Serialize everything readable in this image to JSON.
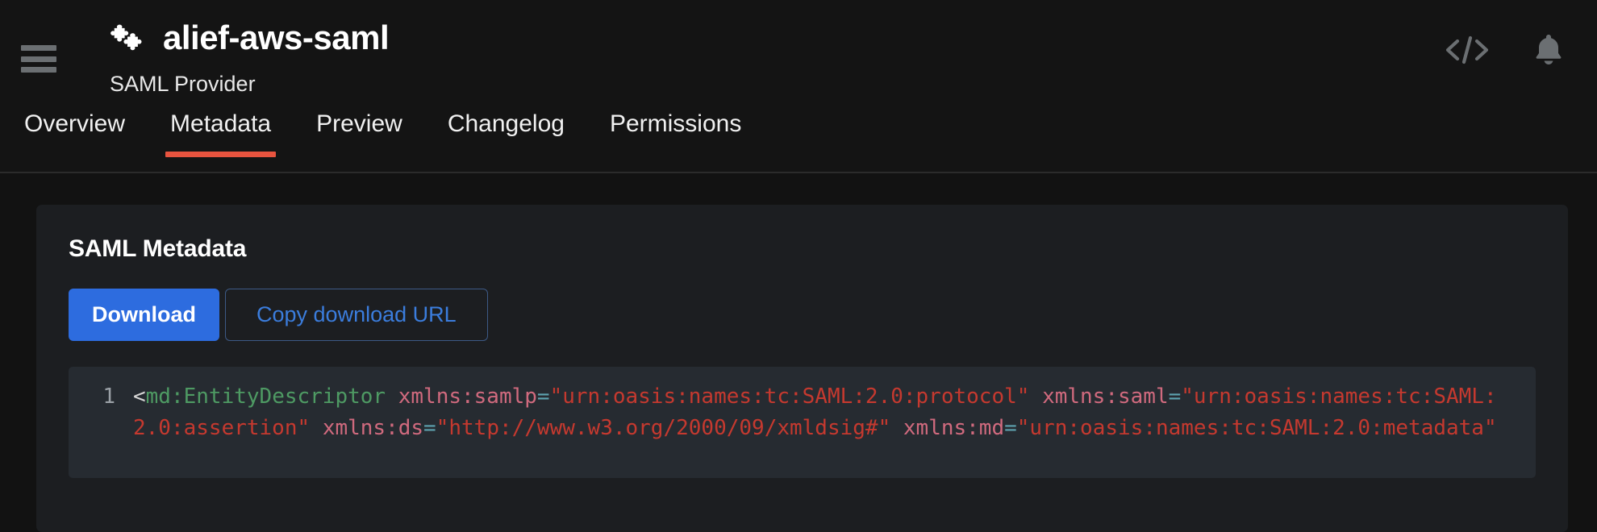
{
  "header": {
    "menu_icon": "hamburger-menu-icon",
    "app_icon": "puzzle-piece-icon",
    "title": "alief-aws-saml",
    "subtitle": "SAML Provider",
    "actions": [
      {
        "name": "code-icon",
        "label": "</>"
      },
      {
        "name": "bell-icon",
        "label": "Notifications"
      }
    ]
  },
  "tabs": [
    {
      "label": "Overview",
      "active": false
    },
    {
      "label": "Metadata",
      "active": true
    },
    {
      "label": "Preview",
      "active": false
    },
    {
      "label": "Changelog",
      "active": false
    },
    {
      "label": "Permissions",
      "active": false
    }
  ],
  "card": {
    "title": "SAML Metadata",
    "download_label": "Download",
    "copy_url_label": "Copy download URL"
  },
  "code": {
    "line_number": "1",
    "tokens": [
      {
        "t": "punct",
        "v": "<"
      },
      {
        "t": "tag",
        "v": "md:EntityDescriptor"
      },
      {
        "t": "punct",
        "v": " "
      },
      {
        "t": "attr",
        "v": "xmlns:samlp"
      },
      {
        "t": "eq",
        "v": "="
      },
      {
        "t": "str",
        "v": "\"urn:oasis:names:tc:SAML:2.0:protocol\""
      },
      {
        "t": "punct",
        "v": " "
      },
      {
        "t": "attr",
        "v": "xmlns:saml"
      },
      {
        "t": "eq",
        "v": "="
      },
      {
        "t": "str",
        "v": "\"urn:oasis:names:tc:SAML:2.0:assertion\""
      },
      {
        "t": "punct",
        "v": " "
      },
      {
        "t": "attr",
        "v": "xmlns:ds"
      },
      {
        "t": "eq",
        "v": "="
      },
      {
        "t": "str",
        "v": "\"http://www.w3.org/2000/09/xmldsig#\""
      },
      {
        "t": "punct",
        "v": " "
      },
      {
        "t": "attr",
        "v": "xmlns:md"
      },
      {
        "t": "eq",
        "v": "="
      },
      {
        "t": "str",
        "v": "\"urn:oasis:names:tc:SAML:2.0:metadata\""
      }
    ]
  },
  "colors": {
    "page_bg": "#121212",
    "header_bg": "#141414",
    "card_bg": "#1c1e21",
    "code_bg": "#262b31",
    "accent_tab": "#e8543f",
    "primary_button": "#2d6cdf",
    "link_blue": "#3b7ddd",
    "icon_gray": "#6b6f72"
  }
}
